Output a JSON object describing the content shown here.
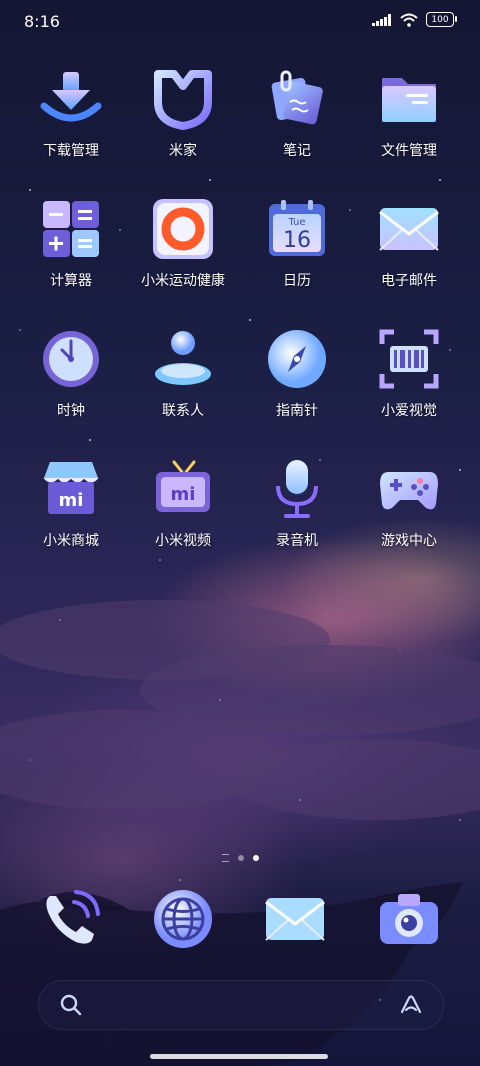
{
  "status": {
    "time": "8:16",
    "battery": "100"
  },
  "apps": [
    {
      "label": "下载管理",
      "icon": "download-icon"
    },
    {
      "label": "米家",
      "icon": "mijia-icon"
    },
    {
      "label": "笔记",
      "icon": "notes-icon"
    },
    {
      "label": "文件管理",
      "icon": "folder-icon"
    },
    {
      "label": "计算器",
      "icon": "calculator-icon"
    },
    {
      "label": "小米运动健康",
      "icon": "fitness-ring-icon"
    },
    {
      "label": "日历",
      "icon": "calendar-icon",
      "day": "Tue",
      "date": "16"
    },
    {
      "label": "电子邮件",
      "icon": "mail-icon"
    },
    {
      "label": "时钟",
      "icon": "clock-icon"
    },
    {
      "label": "联系人",
      "icon": "contacts-icon"
    },
    {
      "label": "指南针",
      "icon": "compass-icon"
    },
    {
      "label": "小爱视觉",
      "icon": "scan-icon"
    },
    {
      "label": "小米商城",
      "icon": "store-icon"
    },
    {
      "label": "小米视频",
      "icon": "tv-icon"
    },
    {
      "label": "录音机",
      "icon": "microphone-icon"
    },
    {
      "label": "游戏中心",
      "icon": "gamepad-icon"
    }
  ],
  "dock": [
    {
      "icon": "phone-icon"
    },
    {
      "icon": "globe-icon"
    },
    {
      "icon": "mail-icon"
    },
    {
      "icon": "camera-icon"
    }
  ],
  "colors": {
    "icon_light": "#e8f1ff",
    "icon_blue": "#6fa8ff",
    "icon_purple": "#8a6cff",
    "accent_orange": "#ff5a2a"
  }
}
